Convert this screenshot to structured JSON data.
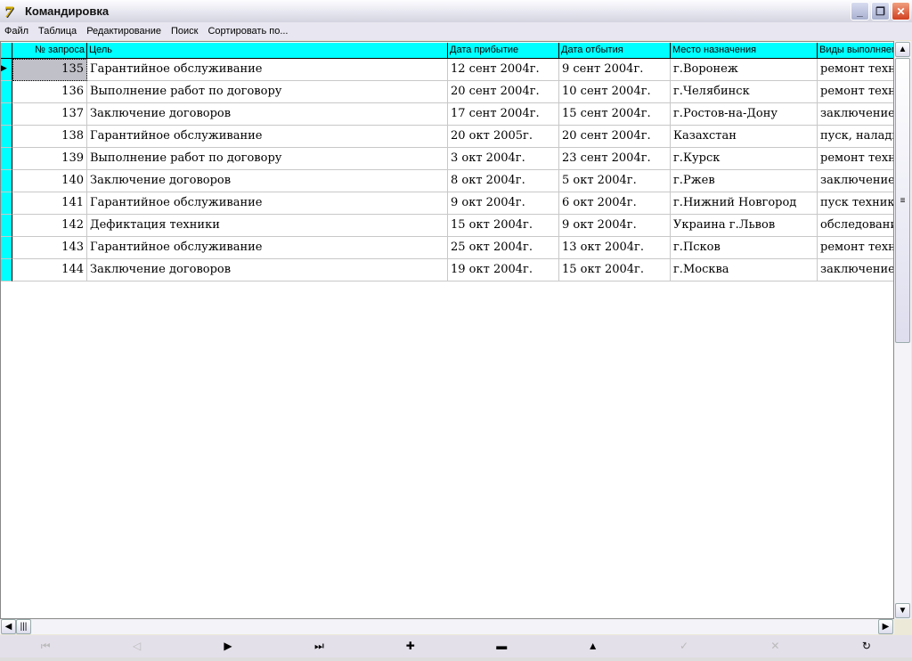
{
  "window": {
    "title": "Командировка"
  },
  "menu": [
    "Файл",
    "Таблица",
    "Редактирование",
    "Поиск",
    "Сортировать по..."
  ],
  "columns": [
    "№ запроса",
    "Цель",
    "Дата прибытие",
    "Дата отбытия",
    "Место назначения",
    "Виды выполняем"
  ],
  "rows": [
    [
      "135",
      "Гарантийное обслуживание",
      "12 сент 2004г.",
      "9 сент 2004г.",
      "г.Воронеж",
      "ремонт техн"
    ],
    [
      "136",
      "Выполнение работ по договору",
      "20 сент 2004г.",
      "10 сент 2004г.",
      "г.Челябинск",
      "ремонт техн"
    ],
    [
      "137",
      "Заключение договоров",
      "17 сент 2004г.",
      "15 сент 2004г.",
      "г.Ростов-на-Дону",
      "заключение"
    ],
    [
      "138",
      "Гарантийное обслуживание",
      "20 окт 2005г.",
      "20 сент 2004г.",
      "Казахстан",
      "пуск, наладк"
    ],
    [
      "139",
      "Выполнение работ по договору",
      "3 окт 2004г.",
      "23 сент 2004г.",
      "г.Курск",
      "ремонт техн"
    ],
    [
      "140",
      "Заключение договоров",
      "8 окт 2004г.",
      "5 окт 2004г.",
      "г.Ржев",
      "заключение"
    ],
    [
      "141",
      "Гарантийное обслуживание",
      "9 окт 2004г.",
      "6 окт 2004г.",
      "г.Нижний Новгород",
      "пуск техник"
    ],
    [
      "142",
      "Дефиктация техники",
      "15 окт 2004г.",
      "9 окт 2004г.",
      "Украина г.Львов",
      "обследовани"
    ],
    [
      "143",
      "Гарантийное обслуживание",
      "25 окт 2004г.",
      "13 окт 2004г.",
      "г.Псков",
      "ремонт техн"
    ],
    [
      "144",
      "Заключение договоров",
      "19 окт 2004г.",
      "15 окт 2004г.",
      "г.Москва",
      "заключение"
    ]
  ],
  "navigator": [
    {
      "name": "first",
      "glyph": "⏮",
      "enabled": false
    },
    {
      "name": "prior",
      "glyph": "◁",
      "enabled": false
    },
    {
      "name": "next",
      "glyph": "▶",
      "enabled": true
    },
    {
      "name": "last",
      "glyph": "⏭",
      "enabled": true
    },
    {
      "name": "insert",
      "glyph": "✚",
      "enabled": true
    },
    {
      "name": "delete",
      "glyph": "▬",
      "enabled": true
    },
    {
      "name": "edit",
      "glyph": "▲",
      "enabled": true
    },
    {
      "name": "post",
      "glyph": "✓",
      "enabled": false
    },
    {
      "name": "cancel",
      "glyph": "✕",
      "enabled": false
    },
    {
      "name": "refresh",
      "glyph": "↻",
      "enabled": true
    }
  ]
}
